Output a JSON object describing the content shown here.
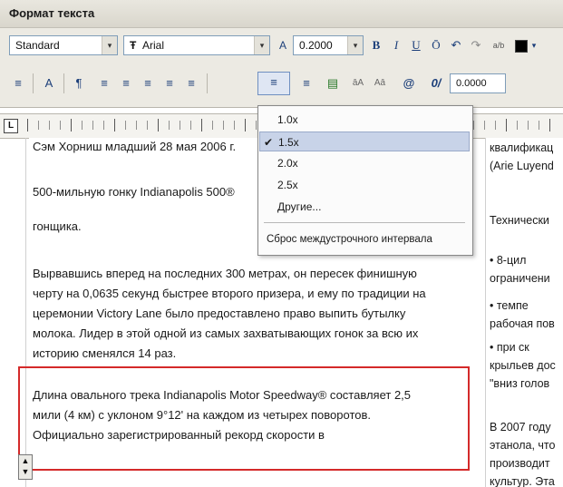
{
  "window": {
    "title": "Формат текста"
  },
  "toolbar1": {
    "style_value": "Standard",
    "font_value": "Arial",
    "font_prefix": "Ŧ",
    "height_value": "0.2000",
    "bold": "B",
    "italic": "I",
    "underline": "U",
    "overline": "Ō",
    "undo": "↶",
    "redo": "↷",
    "stack": "a/b",
    "dropdown_arrow": "▾"
  },
  "toolbar2": {
    "columns": "≡",
    "mtext_justify": "A",
    "para": "¶",
    "align_left": "≡",
    "align_center": "≡",
    "align_right": "≡",
    "justify": "≡",
    "distribute": "≡",
    "line_spacing": "≡",
    "numbering": "≡",
    "insert_field": "▤",
    "uppercase": "āA",
    "lowercase": "Aā",
    "symbol": "@",
    "oblique": "0/",
    "oblique_value": "0.0000"
  },
  "ruler": {
    "label": "L"
  },
  "menu": {
    "items": [
      {
        "label": "1.0x",
        "checked": false
      },
      {
        "label": "1.5x",
        "checked": true
      },
      {
        "label": "2.0x",
        "checked": false
      },
      {
        "label": "2.5x",
        "checked": false
      },
      {
        "label": "Другие...",
        "checked": false
      }
    ],
    "reset_label": "Сброс междустрочного интервала",
    "check_glyph": "✔"
  },
  "document": {
    "lines": [
      "Сэм Хорниш младший 28 мая 2006 г.",
      "500-мильную гонку Indianapolis 500®",
      "гонщика.",
      "Вырвавшись вперед на последних 300 метрах, он пересек финишную",
      "черту на 0,0635 секунд быстрее второго призера, и ему по традиции на",
      "церемонии Victory Lane было предоставлено право выпить бутылку",
      "молока. Лидер в этой одной из самых захватывающих гонок за всю их",
      "историю сменялся 14 раз.",
      "Длина овального трека Indianapolis Motor Speedway® составляет 2,5",
      "мили (4 км) с уклоном 9°12' на каждом из четырех поворотов.",
      "Официально зарегистрированный рекорд скорости  в"
    ],
    "right_lines": [
      "квалификац",
      "(Arie Luyend",
      "Технически",
      "•      8-цил",
      "ограничени",
      "•      темпе",
      "рабочая пов",
      "•      при ск",
      "крыльев дос",
      "\"вниз голов",
      "В 2007 году",
      "этанола, что",
      "производит",
      "культур. Эта"
    ]
  },
  "colors": {
    "panel": "#eceae3",
    "highlight": "#c8d3e8",
    "red_frame": "#d42a2a"
  }
}
